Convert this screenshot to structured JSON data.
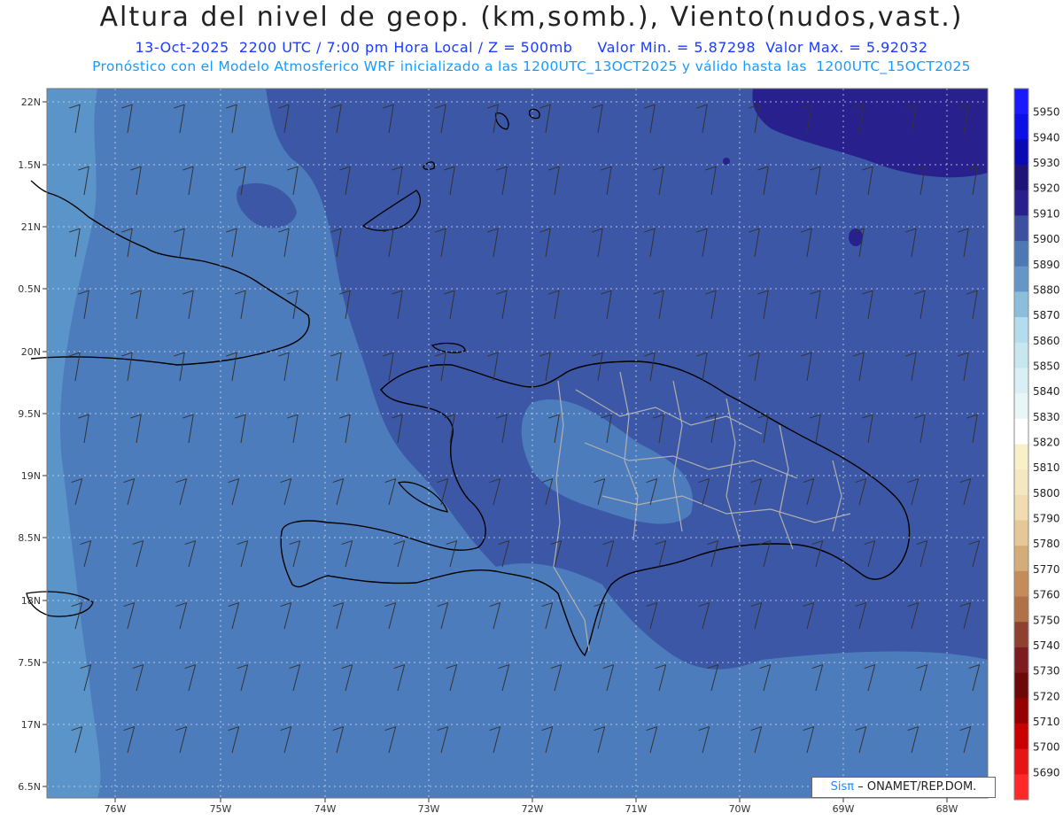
{
  "header": {
    "title": "Altura del nivel de geop. (km,somb.), Viento(nudos,vast.)",
    "subtitle": "13-Oct-2025  2200 UTC / 7:00 pm Hora Local / Z = 500mb     Valor Min. = 5.87298  Valor Max. = 5.92032",
    "model_line": "Pronóstico con el Modelo Atmosferico WRF inicializado a las 1200UTC_13OCT2025 y válido hasta las  1200UTC_15OCT2025"
  },
  "axes": {
    "lat_labels": [
      "22N",
      "1.5N",
      "21N",
      "0.5N",
      "20N",
      "9.5N",
      "19N",
      "8.5N",
      "18N",
      "7.5N",
      "17N",
      "6.5N"
    ],
    "lon_labels": [
      "76W",
      "75W",
      "74W",
      "73W",
      "72W",
      "71W",
      "70W",
      "69W",
      "68W"
    ]
  },
  "colorbar": {
    "labels": [
      "5950",
      "5940",
      "5930",
      "5920",
      "5910",
      "5900",
      "5890",
      "5880",
      "5870",
      "5860",
      "5850",
      "5840",
      "5830",
      "5820",
      "5810",
      "5800",
      "5790",
      "5780",
      "5770",
      "5760",
      "5750",
      "5740",
      "5730",
      "5720",
      "5710",
      "5700",
      "5690"
    ],
    "colors": [
      "#1a1aff",
      "#0e0ee6",
      "#0a0ab4",
      "#1e1478",
      "#28208c",
      "#3c50a0",
      "#4e78b4",
      "#6496c8",
      "#8cbedc",
      "#b4dcec",
      "#c8e6f0",
      "#d8f0f4",
      "#e8f6f8",
      "#ffffff",
      "#f8f0c8",
      "#f4e8c0",
      "#f0dcb0",
      "#e4c898",
      "#d4ac78",
      "#c48c58",
      "#b07048",
      "#904030",
      "#7c1c20",
      "#6c0808",
      "#960000",
      "#c80000",
      "#e61414",
      "#ff2828"
    ]
  },
  "map_colors": {
    "ocean_light": "#5a94c8",
    "mid": "#4d7cbc",
    "dark": "#3c57a5",
    "darker": "#2a2a82",
    "border": "#000000",
    "admin": "#b0b0b0"
  },
  "credit": {
    "brand": "Sisπ",
    "text": "– ONAMET/REP.DOM."
  }
}
